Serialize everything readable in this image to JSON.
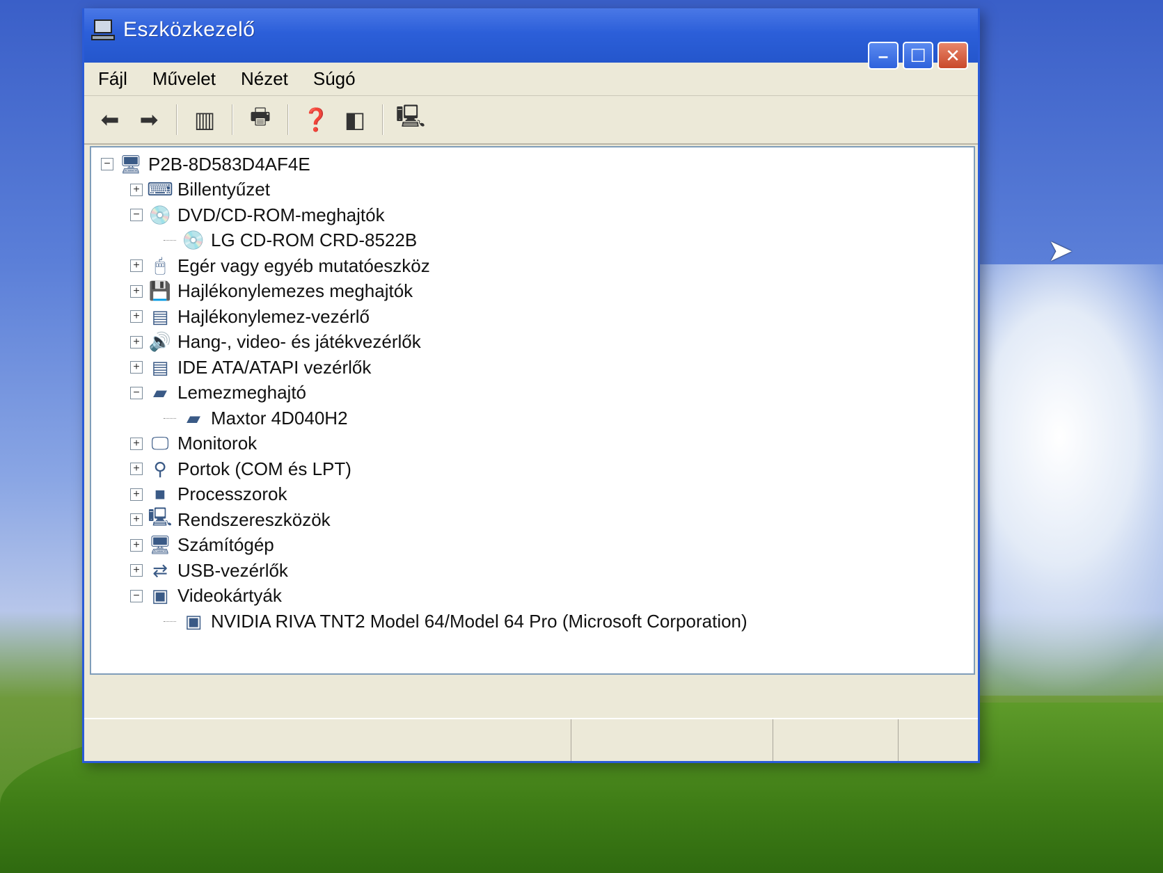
{
  "window": {
    "title": "Eszközkezelő",
    "icon": "computer-monitor-icon",
    "buttons": {
      "minimize": "minimize-icon",
      "maximize": "maximize-icon",
      "close": "close-icon"
    }
  },
  "menu": [
    "Fájl",
    "Művelet",
    "Nézet",
    "Súgó"
  ],
  "toolbar": [
    "back-icon",
    "forward-icon",
    "show-hide-tree-icon",
    "print-icon",
    "properties-help-icon",
    "export-list-icon",
    "scan-hardware-icon"
  ],
  "tree": [
    {
      "level": 0,
      "expander": "−",
      "icon": "computer-icon",
      "label": "P2B-8D583D4AF4E"
    },
    {
      "level": 1,
      "expander": "+",
      "icon": "keyboard-icon",
      "label": "Billentyűzet"
    },
    {
      "level": 1,
      "expander": "−",
      "icon": "cd-drive-icon",
      "label": "DVD/CD-ROM-meghajtók"
    },
    {
      "level": 2,
      "expander": "",
      "icon": "cd-drive-icon",
      "label": "LG CD-ROM CRD-8522B"
    },
    {
      "level": 1,
      "expander": "+",
      "icon": "mouse-icon",
      "label": "Egér vagy egyéb mutatóeszköz"
    },
    {
      "level": 1,
      "expander": "+",
      "icon": "floppy-drive-icon",
      "label": "Hajlékonylemezes meghajtók"
    },
    {
      "level": 1,
      "expander": "+",
      "icon": "controller-icon",
      "label": "Hajlékonylemez-vezérlő"
    },
    {
      "level": 1,
      "expander": "+",
      "icon": "sound-icon",
      "label": "Hang-, video- és játékvezérlők"
    },
    {
      "level": 1,
      "expander": "+",
      "icon": "controller-icon",
      "label": "IDE ATA/ATAPI vezérlők"
    },
    {
      "level": 1,
      "expander": "−",
      "icon": "disk-drive-icon",
      "label": "Lemezmeghajtó"
    },
    {
      "level": 2,
      "expander": "",
      "icon": "disk-drive-icon",
      "label": "Maxtor 4D040H2"
    },
    {
      "level": 1,
      "expander": "+",
      "icon": "monitor-icon",
      "label": "Monitorok"
    },
    {
      "level": 1,
      "expander": "+",
      "icon": "port-icon",
      "label": "Portok (COM és LPT)"
    },
    {
      "level": 1,
      "expander": "+",
      "icon": "processor-icon",
      "label": "Processzorok"
    },
    {
      "level": 1,
      "expander": "+",
      "icon": "system-device-icon",
      "label": "Rendszereszközök"
    },
    {
      "level": 1,
      "expander": "+",
      "icon": "computer-icon",
      "label": "Számítógép"
    },
    {
      "level": 1,
      "expander": "+",
      "icon": "usb-icon",
      "label": "USB-vezérlők"
    },
    {
      "level": 1,
      "expander": "−",
      "icon": "display-adapter-icon",
      "label": "Videokártyák"
    },
    {
      "level": 2,
      "expander": "",
      "icon": "display-adapter-icon",
      "label": "NVIDIA RIVA TNT2 Model 64/Model 64 Pro (Microsoft Corporation)"
    }
  ]
}
